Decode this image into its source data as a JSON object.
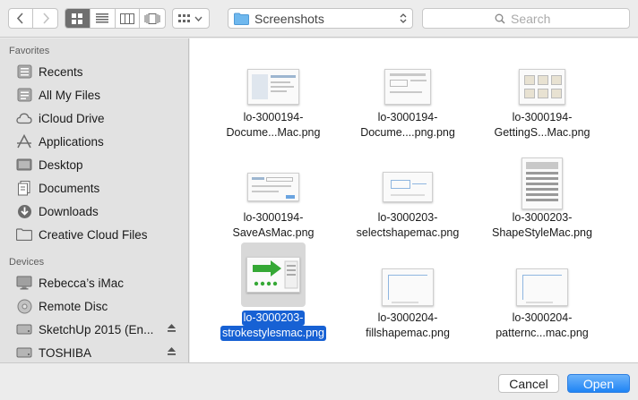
{
  "toolbar": {
    "location": "Screenshots",
    "search_placeholder": "Search"
  },
  "sidebar": {
    "favorites_title": "Favorites",
    "favorites": [
      {
        "label": "Recents",
        "icon": "recents-icon"
      },
      {
        "label": "All My Files",
        "icon": "all-my-files-icon"
      },
      {
        "label": "iCloud Drive",
        "icon": "icloud-drive-icon"
      },
      {
        "label": "Applications",
        "icon": "applications-icon"
      },
      {
        "label": "Desktop",
        "icon": "desktop-icon"
      },
      {
        "label": "Documents",
        "icon": "documents-icon"
      },
      {
        "label": "Downloads",
        "icon": "downloads-icon"
      },
      {
        "label": "Creative Cloud Files",
        "icon": "folder-icon"
      }
    ],
    "devices_title": "Devices",
    "devices": [
      {
        "label": "Rebecca’s iMac",
        "icon": "imac-icon"
      },
      {
        "label": "Remote Disc",
        "icon": "remote-disc-icon"
      },
      {
        "label": "SketchUp 2015 (En...",
        "icon": "disk-icon"
      },
      {
        "label": "TOSHIBA",
        "icon": "disk-icon"
      }
    ]
  },
  "files": [
    {
      "line1": "lo-3000194-",
      "line2": "Docume...Mac.png"
    },
    {
      "line1": "lo-3000194-",
      "line2": "Docume....png.png"
    },
    {
      "line1": "lo-3000194-",
      "line2": "GettingS...Mac.png"
    },
    {
      "line1": "lo-3000194-",
      "line2": "SaveAsMac.png"
    },
    {
      "line1": "lo-3000203-",
      "line2": "selectshapemac.png"
    },
    {
      "line1": "lo-3000203-",
      "line2": "ShapeStyleMac.png"
    },
    {
      "line1": "lo-3000203-",
      "line2": "strokestylesmac.png"
    },
    {
      "line1": "lo-3000204-",
      "line2": "fillshapemac.png"
    },
    {
      "line1": "lo-3000204-",
      "line2": "patternc...mac.png"
    }
  ],
  "selected_file": "lo-3000203-strokestylesmac.png",
  "buttons": {
    "cancel": "Cancel",
    "open": "Open"
  },
  "colors": {
    "accent": "#1761d4",
    "open_button": "#1f84f5",
    "sidebar_bg": "#e2e2e2"
  }
}
